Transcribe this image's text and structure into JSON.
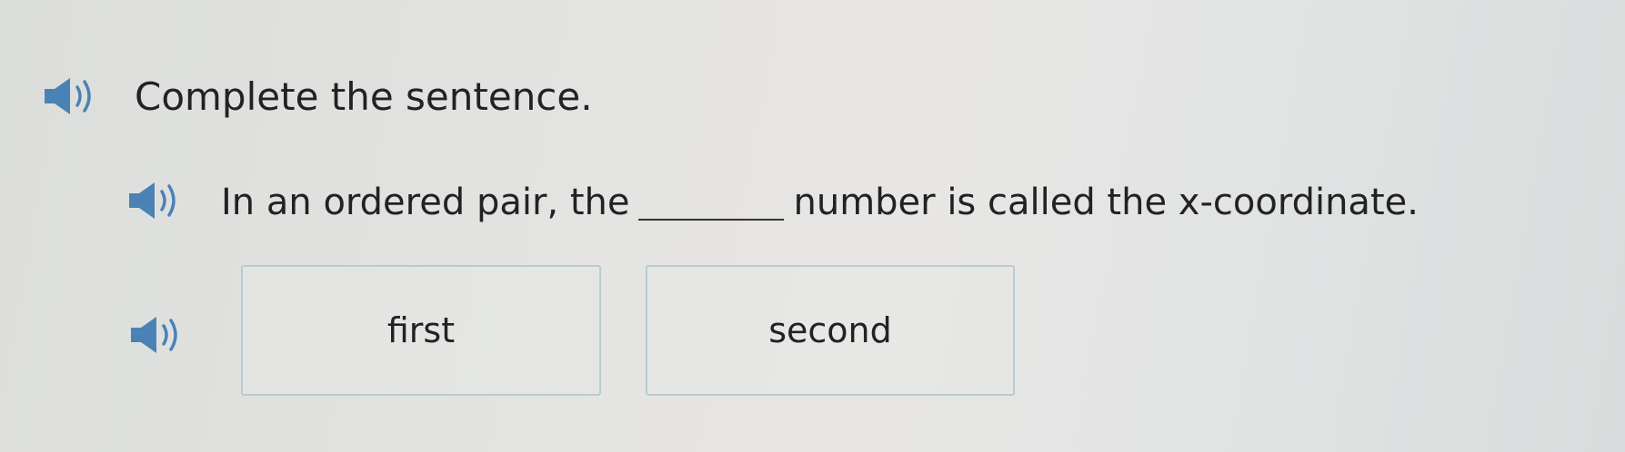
{
  "question": {
    "instruction": "Complete the sentence.",
    "sentence_before": "In an ordered pair, the",
    "sentence_after": "number is called the x-coordinate."
  },
  "choices": [
    {
      "label": "first"
    },
    {
      "label": "second"
    }
  ],
  "icons": {
    "audio": "speaker-icon"
  },
  "colors": {
    "speaker_icon": "#4a82b6",
    "choice_border": "#b7ccd3",
    "text": "#222222"
  }
}
